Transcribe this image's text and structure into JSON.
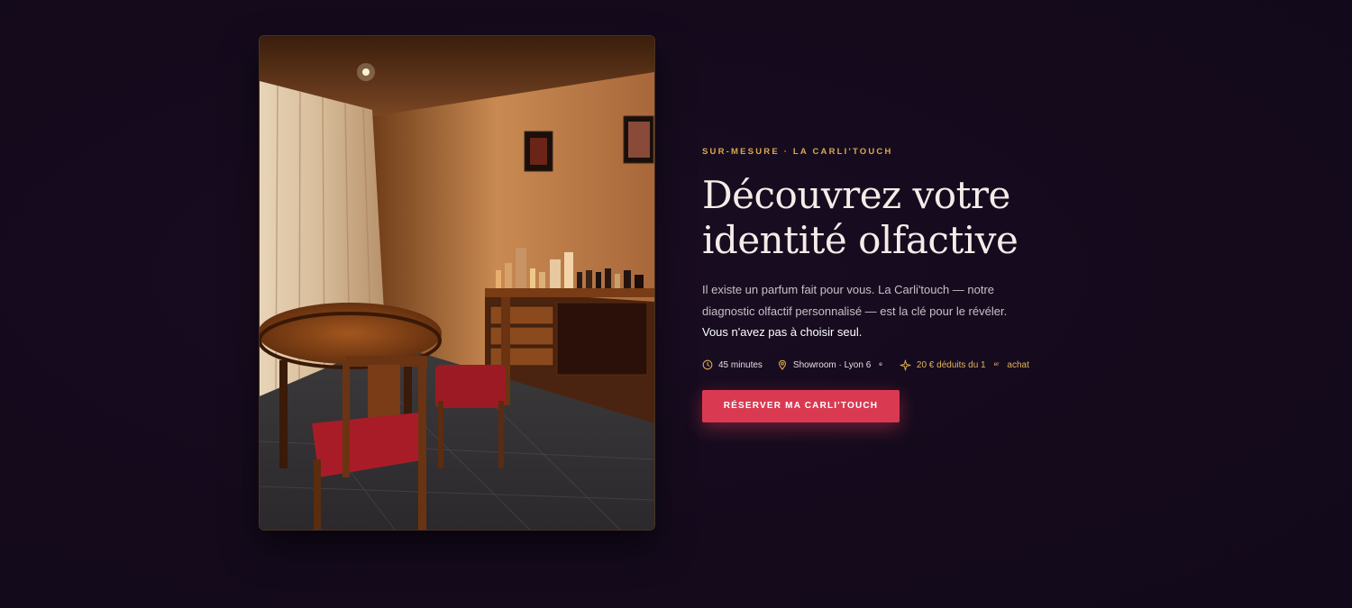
{
  "section": {
    "eyebrow": "SUR-MESURE · LA CARLI'TOUCH",
    "title_line1": "Découvrez votre",
    "title_line2": "identité olfactive",
    "intro_text": "Il existe un parfum fait pour vous. La Carli'touch — notre diagnostic olfactif personnalisé — est la clé pour le révéler. ",
    "intro_emphasis": "Vous n'avez pas à choisir seul.",
    "meta": {
      "duration": "45 minutes",
      "location_main": "Showroom · Lyon 6",
      "location_sup": "e",
      "discount_main": "20 € déduits du 1",
      "discount_sup": "er",
      "discount_tail": "achat"
    },
    "cta_label": "RÉSERVER MA CARLI'TOUCH"
  },
  "icons": {
    "duration": "clock-icon",
    "location": "map-pin-icon",
    "discount": "sparkle-icon"
  },
  "colors": {
    "background": "#140a1c",
    "accent_gold": "#d9a94f",
    "cta": "#d93a52"
  }
}
